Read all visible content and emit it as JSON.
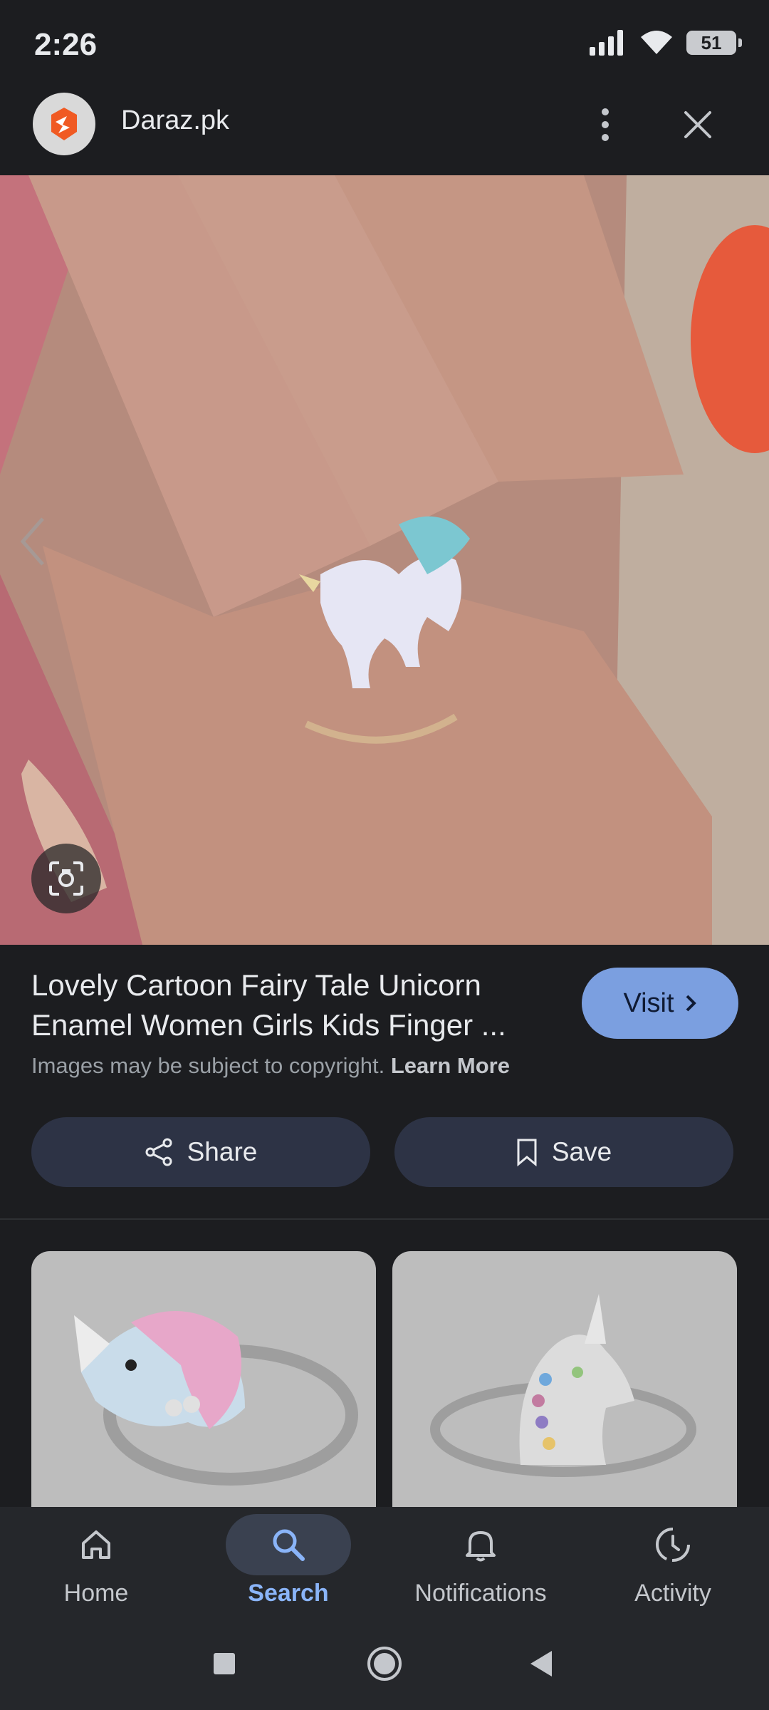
{
  "status_bar": {
    "time": "2:26",
    "battery": "51"
  },
  "header": {
    "site_name": "Daraz.pk"
  },
  "result": {
    "title_line1": "Lovely Cartoon Fairy Tale Unicorn",
    "title_line2": "Enamel Women Girls Kids Finger ...",
    "visit_label": "Visit",
    "copyright_text": "Images may be subject to copyright.",
    "learn_more": "Learn More",
    "share_label": "Share",
    "save_label": "Save"
  },
  "bottom_nav": {
    "items": [
      {
        "label": "Home",
        "icon": "home-icon"
      },
      {
        "label": "Search",
        "icon": "search-icon"
      },
      {
        "label": "Notifications",
        "icon": "bell-icon"
      },
      {
        "label": "Activity",
        "icon": "activity-icon"
      }
    ],
    "active": "Search"
  },
  "colors": {
    "accent": "#8ab4f8",
    "visit_button": "#7b9fe0",
    "site_brand": "#f05a23"
  }
}
